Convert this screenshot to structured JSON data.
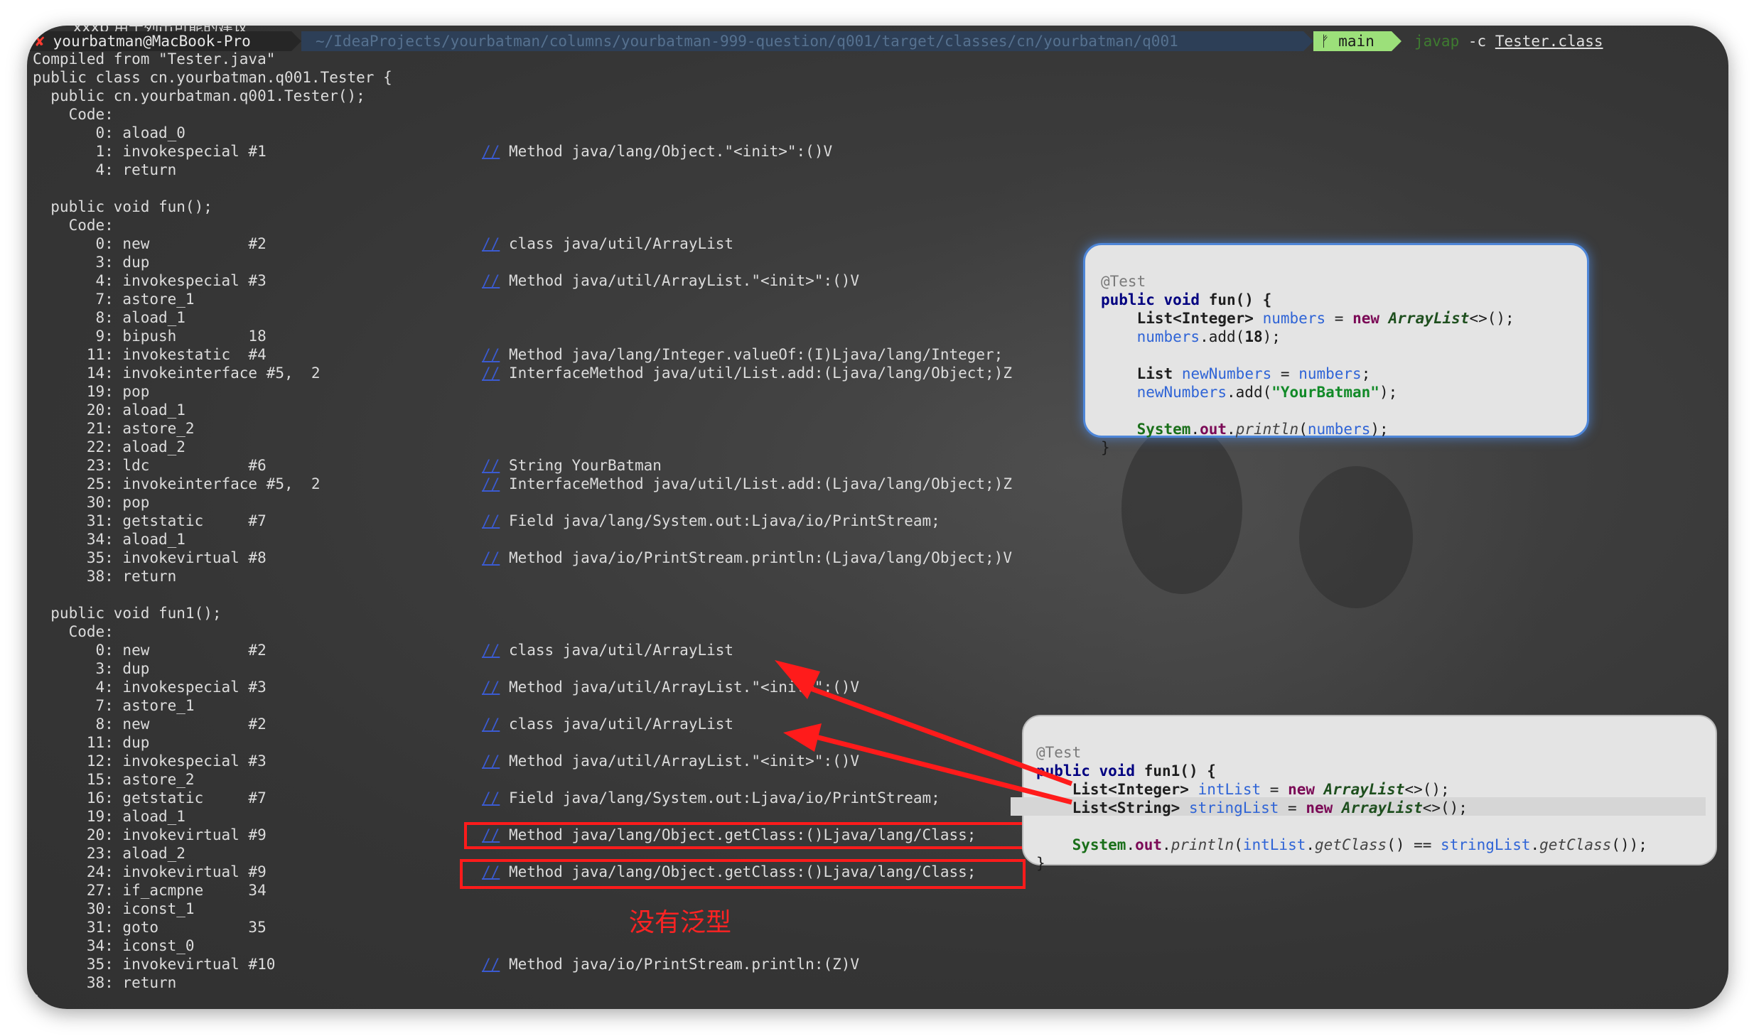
{
  "top_hint": " xxxp 用于列出可能的建议",
  "prompt": {
    "status_icon": "✘",
    "user_host": "yourbatman@MacBook-Pro",
    "path": "~/IdeaProjects/yourbatman/columns/yourbatman-999-question/q001/target/classes/cn/yourbatman/q001",
    "branch_icon": "ᚠ",
    "branch": "main",
    "command": "javap",
    "args": "-c",
    "file": "Tester.class"
  },
  "bytecode_lines": [
    {
      "text": "Compiled from \"Tester.java\"",
      "comment": ""
    },
    {
      "text": "public class cn.yourbatman.q001.Tester {",
      "comment": ""
    },
    {
      "text": "  public cn.yourbatman.q001.Tester();",
      "comment": ""
    },
    {
      "text": "    Code:",
      "comment": ""
    },
    {
      "text": "       0: aload_0",
      "comment": ""
    },
    {
      "text": "       1: invokespecial #1",
      "comment": "Method java/lang/Object.\"<init>\":()V"
    },
    {
      "text": "       4: return",
      "comment": ""
    },
    {
      "text": "",
      "comment": ""
    },
    {
      "text": "  public void fun();",
      "comment": ""
    },
    {
      "text": "    Code:",
      "comment": ""
    },
    {
      "text": "       0: new           #2",
      "comment": "class java/util/ArrayList"
    },
    {
      "text": "       3: dup",
      "comment": ""
    },
    {
      "text": "       4: invokespecial #3",
      "comment": "Method java/util/ArrayList.\"<init>\":()V"
    },
    {
      "text": "       7: astore_1",
      "comment": ""
    },
    {
      "text": "       8: aload_1",
      "comment": ""
    },
    {
      "text": "       9: bipush        18",
      "comment": ""
    },
    {
      "text": "      11: invokestatic  #4",
      "comment": "Method java/lang/Integer.valueOf:(I)Ljava/lang/Integer;"
    },
    {
      "text": "      14: invokeinterface #5,  2",
      "comment": "InterfaceMethod java/util/List.add:(Ljava/lang/Object;)Z"
    },
    {
      "text": "      19: pop",
      "comment": ""
    },
    {
      "text": "      20: aload_1",
      "comment": ""
    },
    {
      "text": "      21: astore_2",
      "comment": ""
    },
    {
      "text": "      22: aload_2",
      "comment": ""
    },
    {
      "text": "      23: ldc           #6",
      "comment": "String YourBatman"
    },
    {
      "text": "      25: invokeinterface #5,  2",
      "comment": "InterfaceMethod java/util/List.add:(Ljava/lang/Object;)Z"
    },
    {
      "text": "      30: pop",
      "comment": ""
    },
    {
      "text": "      31: getstatic     #7",
      "comment": "Field java/lang/System.out:Ljava/io/PrintStream;"
    },
    {
      "text": "      34: aload_1",
      "comment": ""
    },
    {
      "text": "      35: invokevirtual #8",
      "comment": "Method java/io/PrintStream.println:(Ljava/lang/Object;)V"
    },
    {
      "text": "      38: return",
      "comment": ""
    },
    {
      "text": "",
      "comment": ""
    },
    {
      "text": "  public void fun1();",
      "comment": ""
    },
    {
      "text": "    Code:",
      "comment": ""
    },
    {
      "text": "       0: new           #2",
      "comment": "class java/util/ArrayList"
    },
    {
      "text": "       3: dup",
      "comment": ""
    },
    {
      "text": "       4: invokespecial #3",
      "comment": "Method java/util/ArrayList.\"<init>\":()V"
    },
    {
      "text": "       7: astore_1",
      "comment": ""
    },
    {
      "text": "       8: new           #2",
      "comment": "class java/util/ArrayList"
    },
    {
      "text": "      11: dup",
      "comment": ""
    },
    {
      "text": "      12: invokespecial #3",
      "comment": "Method java/util/ArrayList.\"<init>\":()V"
    },
    {
      "text": "      15: astore_2",
      "comment": ""
    },
    {
      "text": "      16: getstatic     #7",
      "comment": "Field java/lang/System.out:Ljava/io/PrintStream;"
    },
    {
      "text": "      19: aload_1",
      "comment": ""
    },
    {
      "text": "      20: invokevirtual #9",
      "comment": "Method java/lang/Object.getClass:()Ljava/lang/Class;"
    },
    {
      "text": "      23: aload_2",
      "comment": ""
    },
    {
      "text": "      24: invokevirtual #9",
      "comment": "Method java/lang/Object.getClass:()Ljava/lang/Class;"
    },
    {
      "text": "      27: if_acmpne     34",
      "comment": ""
    },
    {
      "text": "      30: iconst_1",
      "comment": ""
    },
    {
      "text": "      31: goto          35",
      "comment": ""
    },
    {
      "text": "      34: iconst_0",
      "comment": ""
    },
    {
      "text": "      35: invokevirtual #10",
      "comment": "Method java/io/PrintStream.println:(Z)V"
    },
    {
      "text": "      38: return",
      "comment": ""
    },
    {
      "text": "}",
      "comment": ""
    }
  ],
  "comment_slash": "//",
  "popup_fun": {
    "annotation": "@Test",
    "l1_kw": "public void",
    "l1_name": "fun() {",
    "l2_type": "List<Integer>",
    "l2_var": "numbers",
    "l2_eq": " = ",
    "l2_new": "new",
    "l2_cls": "ArrayList",
    "l2_end": "<>();",
    "l3_var": "numbers",
    "l3_call": ".add(",
    "l3_num": "18",
    "l3_end": ");",
    "l4_type": "List",
    "l4_var": "newNumbers",
    "l4_eq": " = ",
    "l4_rhs": "numbers",
    "l4_end": ";",
    "l5_var": "newNumbers",
    "l5_call": ".add(",
    "l5_str": "\"YourBatman\"",
    "l5_end": ");",
    "l6_sys": "System",
    "l6_dot": ".",
    "l6_out": "out",
    "l6_dot2": ".",
    "l6_m": "println",
    "l6_open": "(",
    "l6_var": "numbers",
    "l6_end": ");",
    "close": "}"
  },
  "popup_fun1": {
    "annotation": "@Test",
    "l1_kw": "public void",
    "l1_name": "fun1() {",
    "l2_type": "List<Integer>",
    "l2_var": "intList",
    "l2_eq": " = ",
    "l2_new": "new",
    "l2_cls": "ArrayList",
    "l2_end": "<>();",
    "l3_type": "List<String>",
    "l3_var": "stringList",
    "l3_eq": " = ",
    "l3_new": "new",
    "l3_cls": "ArrayList",
    "l3_end": "<>();",
    "l4_sys": "System",
    "l4_dot": ".",
    "l4_out": "out",
    "l4_dot2": ".",
    "l4_m": "println",
    "l4_open": "(",
    "l4_v1": "intList",
    "l4_dot3": ".",
    "l4_m1": "getClass",
    "l4_mid": "() == ",
    "l4_v2": "stringList",
    "l4_dot4": ".",
    "l4_m2": "getClass",
    "l4_end": "());",
    "close": "}"
  },
  "annotation_label": "没有泛型",
  "colors": {
    "highlight_red": "#ff1b1b",
    "comment_slash": "#3b5bd1",
    "popup_border_blue": "#4e86d8",
    "git_segment": "#9ce07a"
  }
}
